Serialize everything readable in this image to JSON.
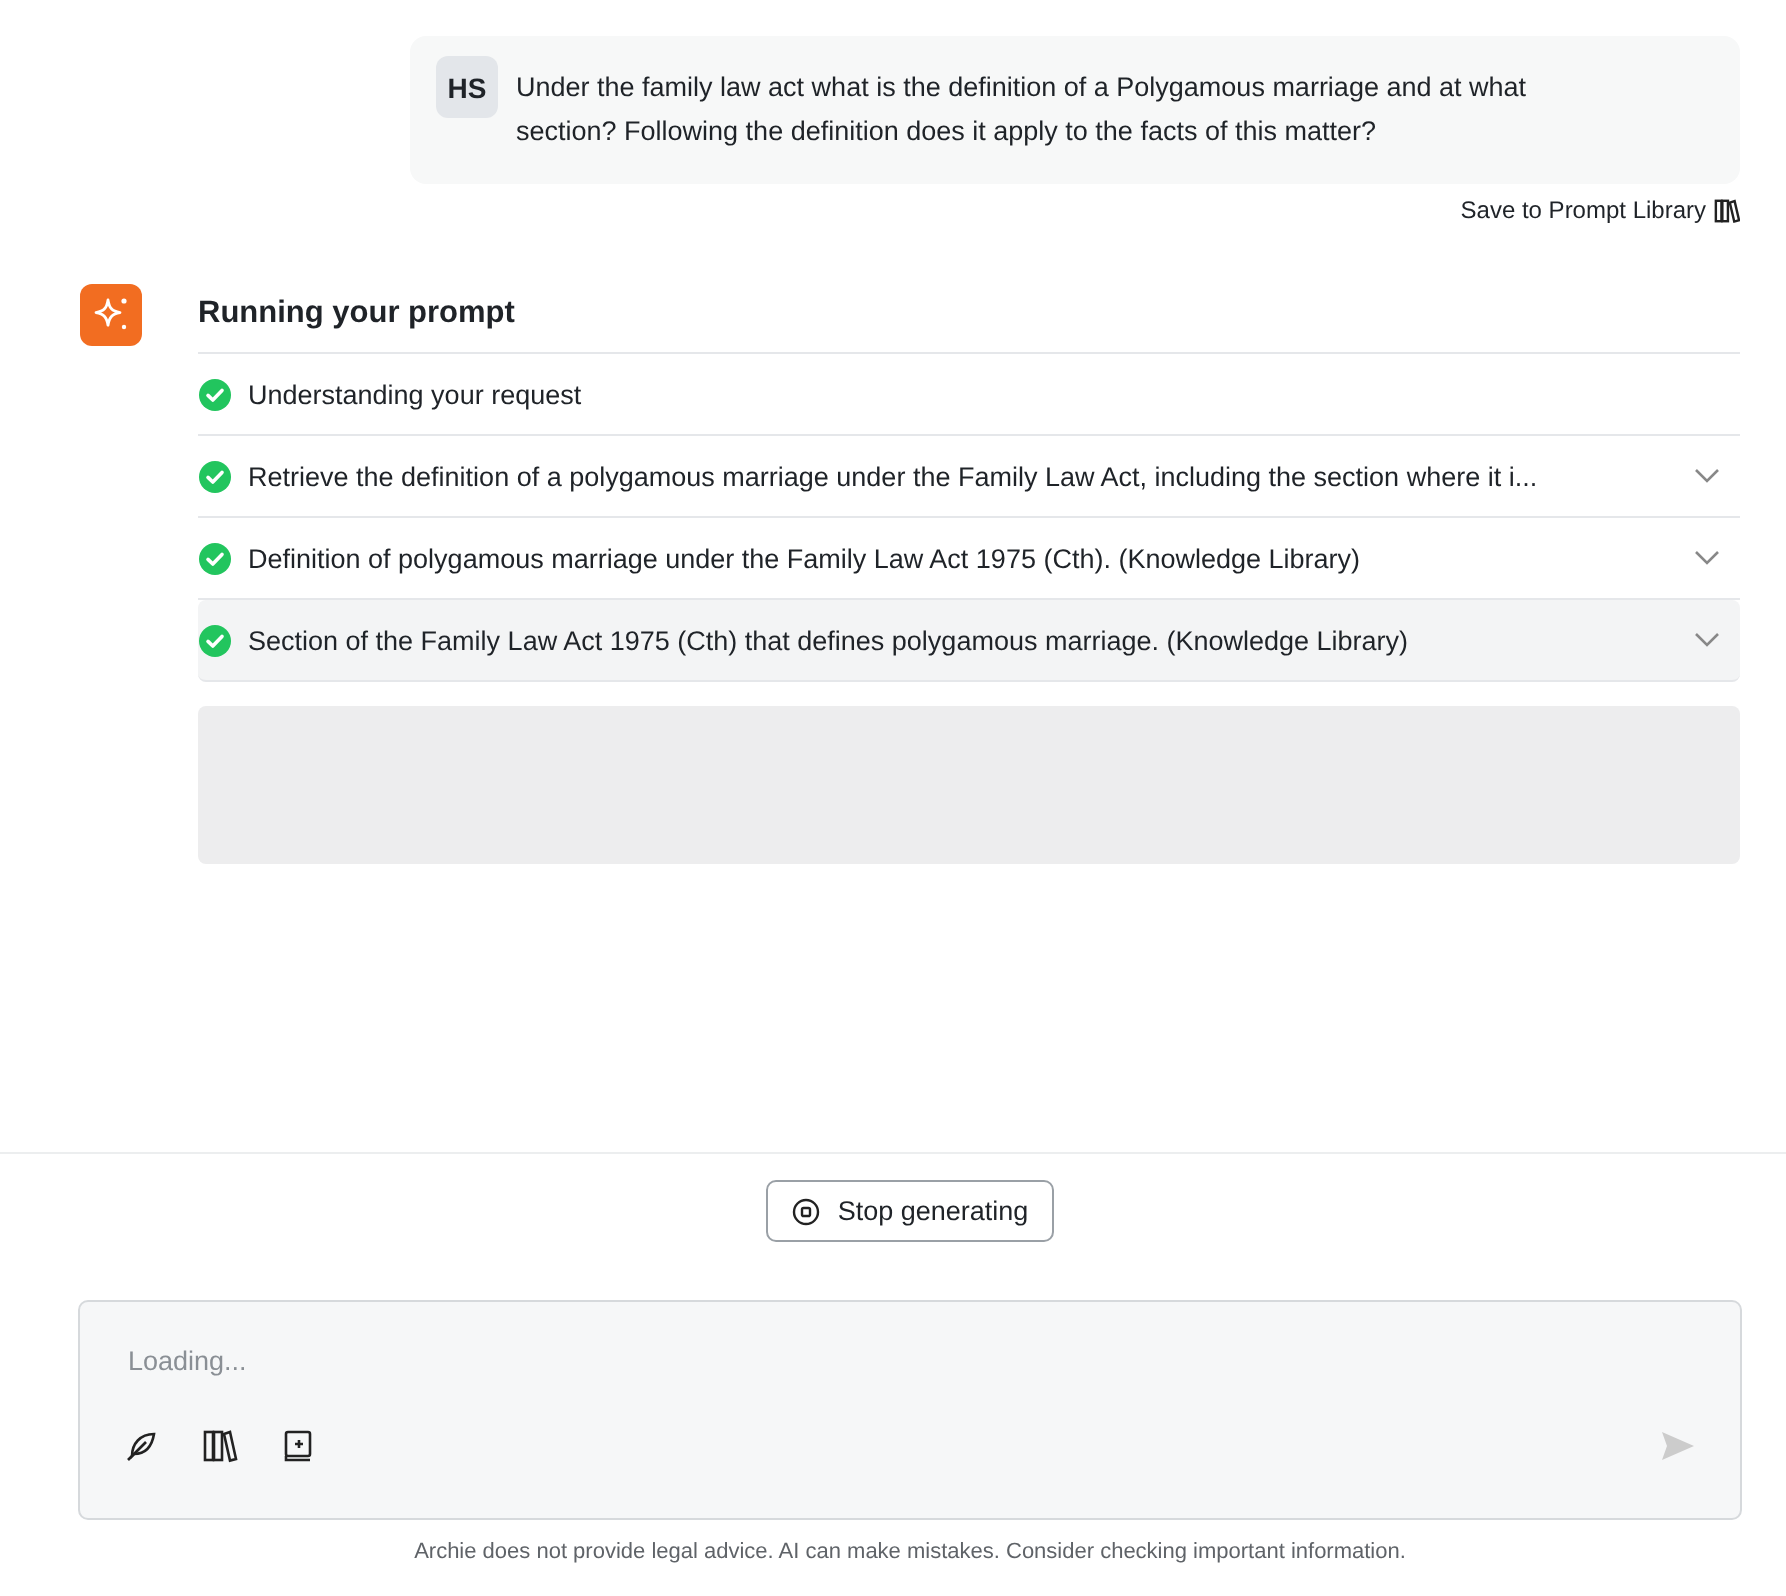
{
  "user_message": {
    "initials": "HS",
    "text": "Under the family law act what is the definition of a Polygamous marriage and at what section? Following the definition does it apply to the facts of this matter?"
  },
  "save_link": "Save to Prompt Library",
  "run": {
    "title": "Running your prompt",
    "steps": [
      {
        "text": "Understanding your request",
        "done": true,
        "expandable": false,
        "highlighted": false
      },
      {
        "text": "Retrieve the definition of a polygamous marriage under the Family Law Act, including the section where it i...",
        "done": true,
        "expandable": true,
        "highlighted": false
      },
      {
        "text": "Definition of polygamous marriage under the Family Law Act 1975 (Cth). (Knowledge Library)",
        "done": true,
        "expandable": true,
        "highlighted": false
      },
      {
        "text": "Section of the Family Law Act 1975 (Cth) that defines polygamous marriage. (Knowledge Library)",
        "done": true,
        "expandable": true,
        "highlighted": true
      }
    ]
  },
  "stop_button": "Stop generating",
  "composer": {
    "placeholder": "Loading..."
  },
  "disclaimer": "Archie does not provide legal advice. AI can make mistakes. Consider checking important information."
}
